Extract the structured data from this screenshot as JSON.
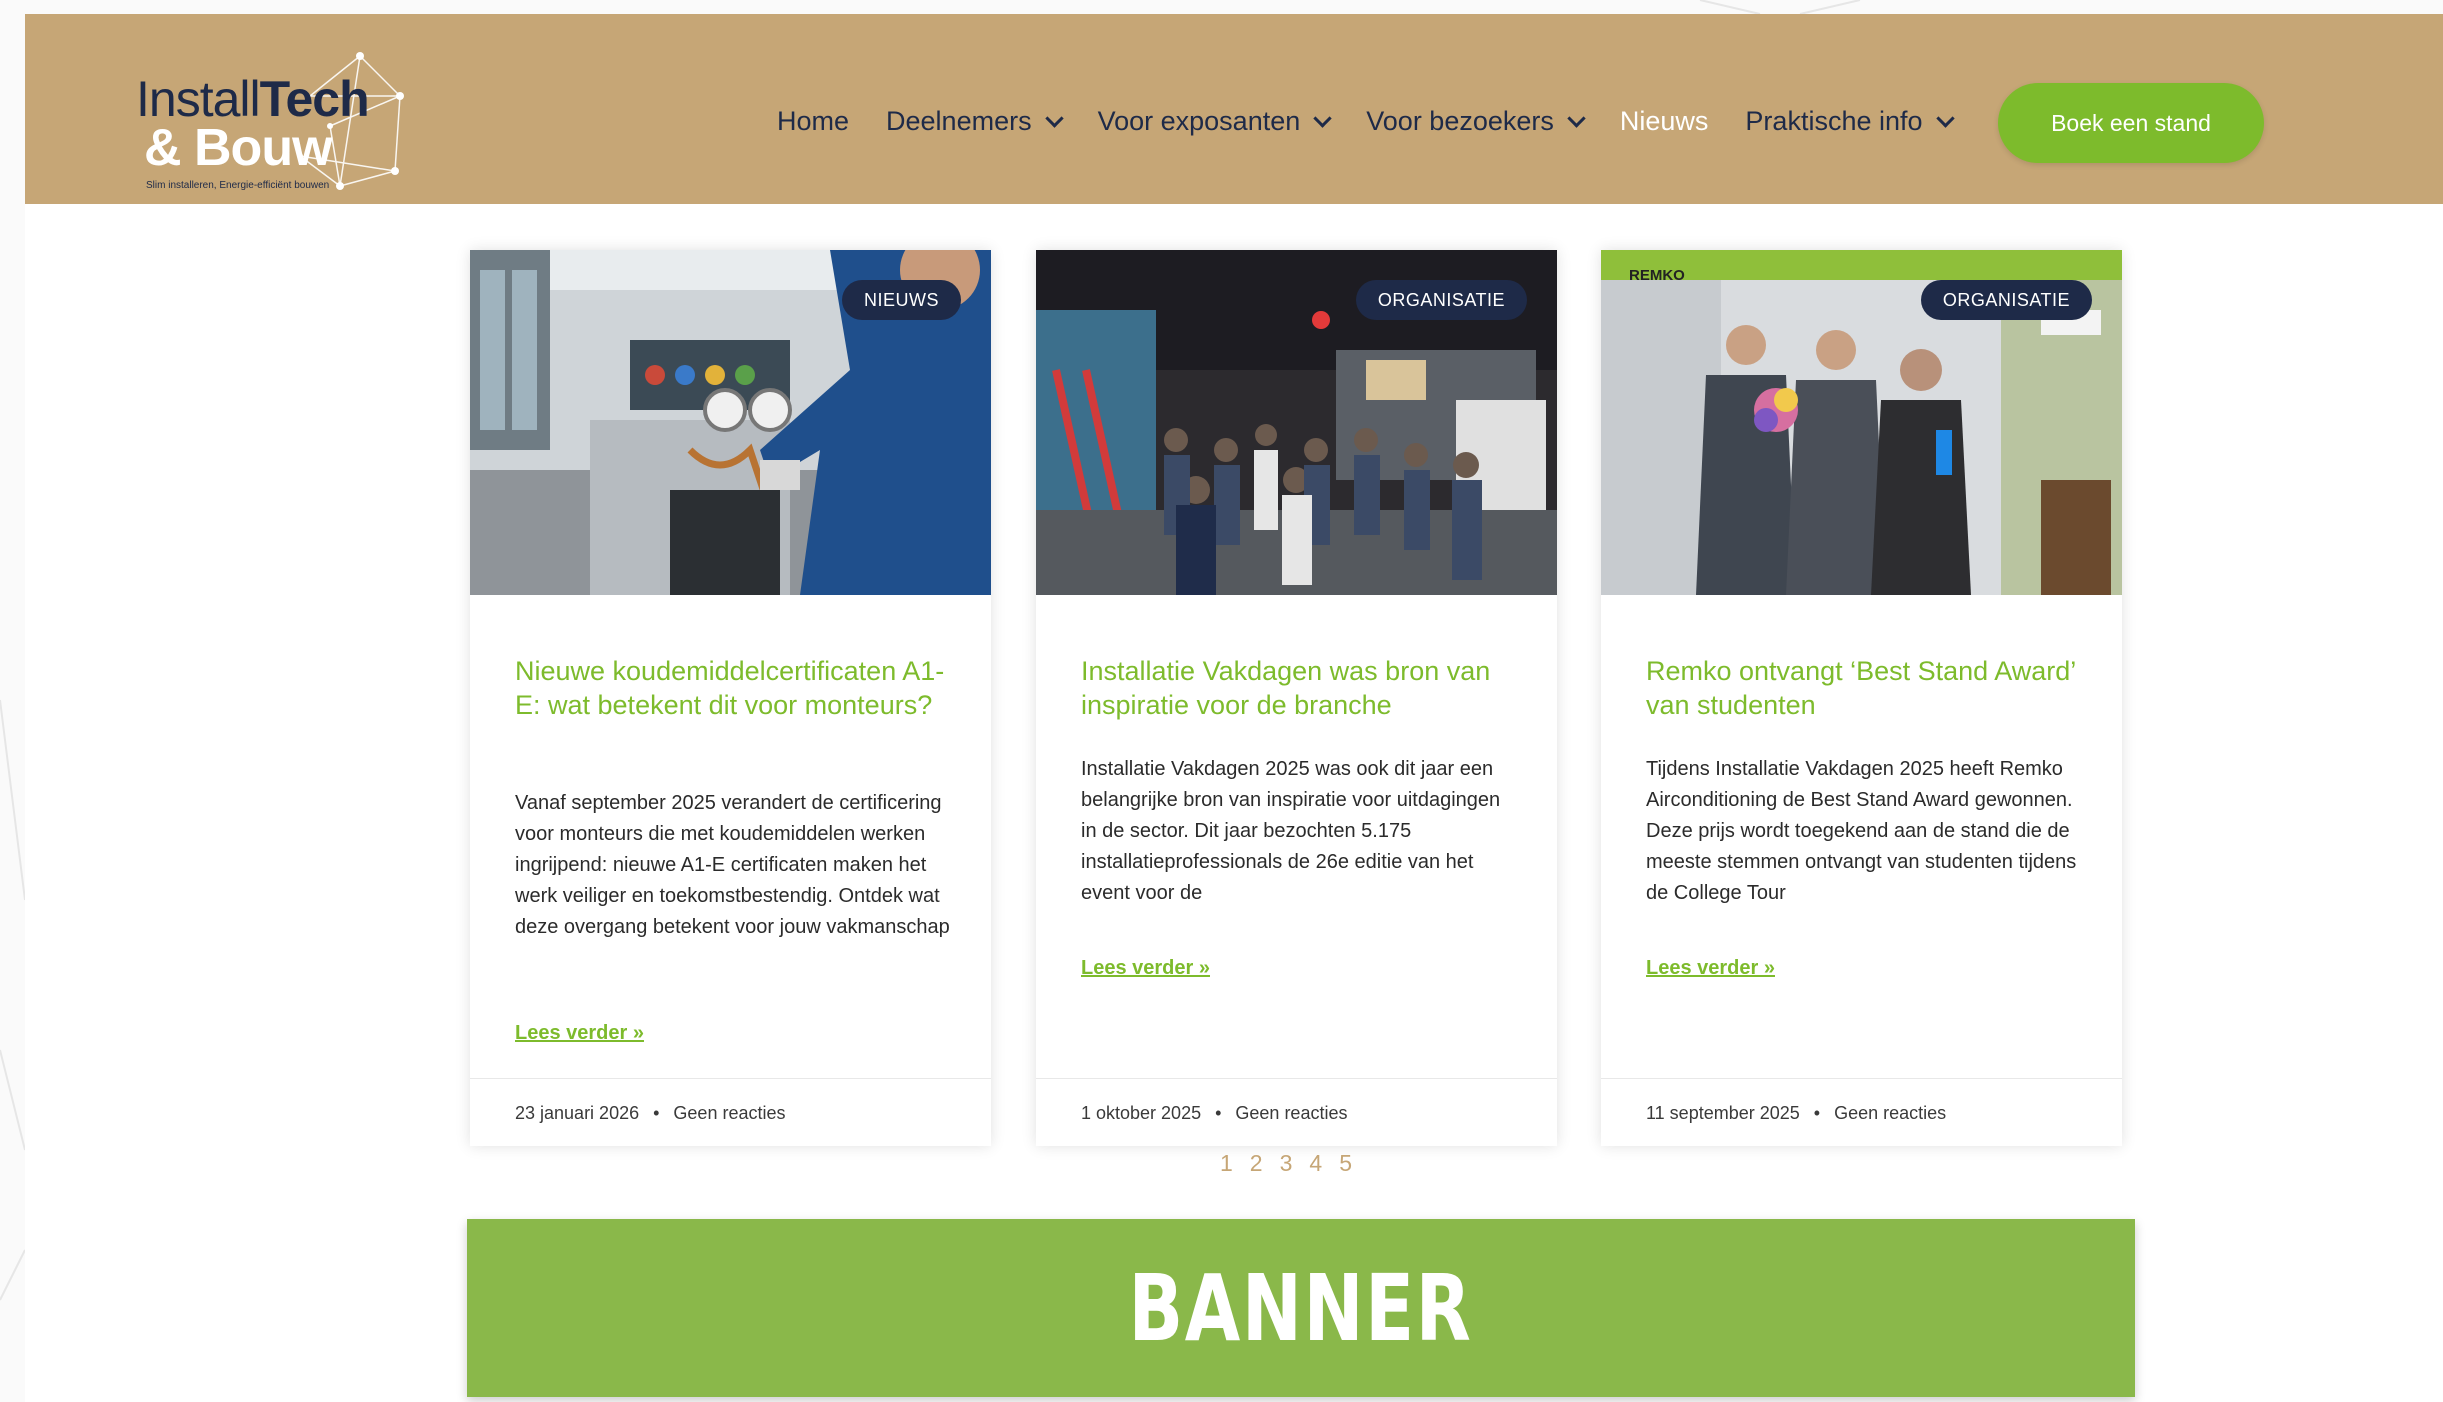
{
  "brand": {
    "logo_line1_light": "Install",
    "logo_line1_bold": "Tech",
    "logo_line2": "& Bouw",
    "logo_tagline": "Slim installeren, Energie-efficiënt bouwen"
  },
  "nav": {
    "items": [
      {
        "label": "Home",
        "has_dropdown": false,
        "active": false
      },
      {
        "label": "Deelnemers",
        "has_dropdown": true,
        "active": false
      },
      {
        "label": "Voor exposanten",
        "has_dropdown": true,
        "active": false
      },
      {
        "label": "Voor bezoekers",
        "has_dropdown": true,
        "active": false
      },
      {
        "label": "Nieuws",
        "has_dropdown": false,
        "active": true
      },
      {
        "label": "Praktische info",
        "has_dropdown": true,
        "active": false
      }
    ],
    "cta_label": "Boek een stand"
  },
  "posts": [
    {
      "badge": "NIEUWS",
      "title": "Nieuwe koudemiddelcertificaten A1-E: wat betekent dit voor monteurs?",
      "excerpt": "Vanaf september 2025 verandert de certificering voor monteurs die met koudemiddelen werken ingrijpend: nieuwe A1-E certificaten maken het werk veiliger en toekomstbestendig. Ontdek wat deze overgang betekent voor jouw vakmanschap",
      "read_more": "Lees verder »",
      "date": "23 januari 2026",
      "comments": "Geen reacties",
      "image": "technician-workshop-photo"
    },
    {
      "badge": "ORGANISATIE",
      "title": "Installatie Vakdagen was bron van inspiratie voor de branche",
      "excerpt": "Installatie Vakdagen 2025 was ook dit jaar een belangrijke bron van inspiratie voor uitdagingen in de sector.  Dit jaar bezochten 5.175 installatieprofessionals de 26e editie van het event voor de",
      "read_more": "Lees verder »",
      "date": "1 oktober 2025",
      "comments": "Geen reacties",
      "image": "trade-fair-crowd-photo"
    },
    {
      "badge": "ORGANISATIE",
      "title": "Remko ontvangt ‘Best Stand Award’ van studenten",
      "excerpt": "Tijdens Installatie Vakdagen 2025 heeft Remko Airconditioning de Best Stand Award gewonnen. Deze prijs wordt toegekend aan de stand die de meeste stemmen ontvangt van studenten tijdens de College Tour",
      "read_more": "Lees verder »",
      "date": "11 september 2025",
      "comments": "Geen reacties",
      "image": "award-stand-photo",
      "image_label": "REMKO"
    }
  ],
  "meta_separator": "•",
  "pagination": [
    "1",
    "2",
    "3",
    "4",
    "5"
  ],
  "banner": {
    "text": "BANNER"
  },
  "colors": {
    "header_bg": "#c6a676",
    "navy": "#1e2a48",
    "green": "#7dbb2c",
    "banner_green": "#8ab84a",
    "pagination": "#c6a676"
  }
}
